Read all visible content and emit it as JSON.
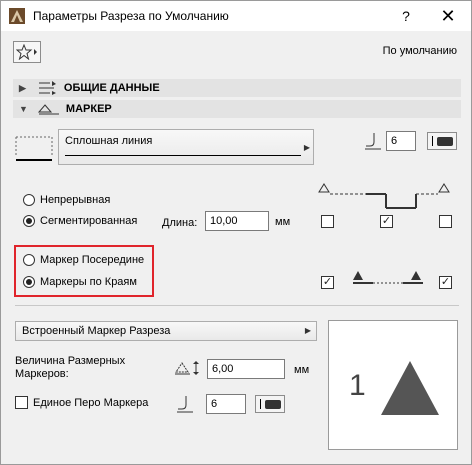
{
  "window": {
    "title": "Параметры Разреза по Умолчанию",
    "help_label": "?",
    "close_label": "✕"
  },
  "toolbar": {
    "default_label": "По умолчанию"
  },
  "sections": {
    "general": "ОБЩИЕ ДАННЫЕ",
    "marker": "МАРКЕР"
  },
  "line": {
    "type_label": "Сплошная линия",
    "pen_value": "6"
  },
  "mode": {
    "continuous_label": "Непрерывная",
    "segmented_label": "Сегментированная",
    "selected": "segmented",
    "length_label": "Длина:",
    "length_value": "10,00",
    "length_unit": "мм"
  },
  "marker_position": {
    "middle_label": "Маркер Посередине",
    "edges_label": "Маркеры по Краям",
    "selected": "edges"
  },
  "segment_checks": {
    "left": false,
    "middle": true,
    "right": false
  },
  "marker_checks": {
    "left": true,
    "right": true
  },
  "marker_settings": {
    "dropdown_label": "Встроенный Маркер Разреза",
    "size_label_line1": "Величина Размерных",
    "size_label_line2": "Маркеров:",
    "size_value": "6,00",
    "size_unit": "мм",
    "uniform_pen_label": "Единое Перо Маркера",
    "uniform_pen_checked": false,
    "pen_value": "6"
  },
  "preview": {
    "number": "1"
  },
  "colors": {
    "highlight_frame": "#e0242b",
    "marker_fill": "#555555"
  }
}
